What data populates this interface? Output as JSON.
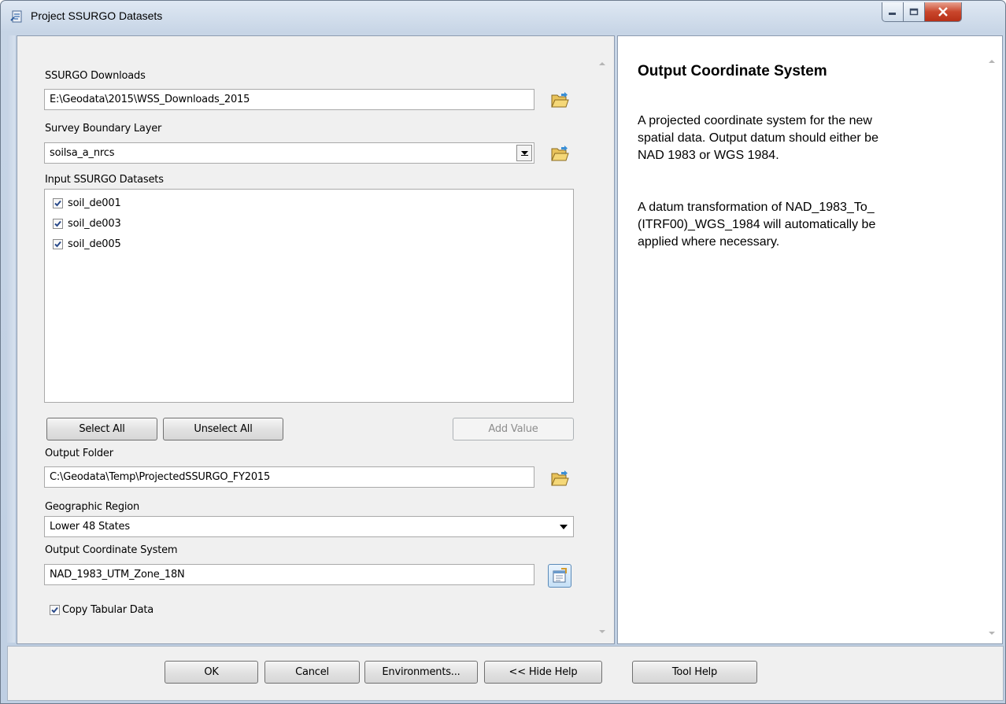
{
  "window": {
    "title": "Project SSURGO Datasets"
  },
  "form": {
    "ssurgo_downloads": {
      "label": "SSURGO Downloads",
      "value": "E:\\Geodata\\2015\\WSS_Downloads_2015"
    },
    "survey_boundary_layer": {
      "label": "Survey Boundary Layer",
      "value": "soilsa_a_nrcs"
    },
    "input_datasets": {
      "label": "Input SSURGO Datasets",
      "items": [
        {
          "label": "soil_de001",
          "checked": true
        },
        {
          "label": "soil_de003",
          "checked": true
        },
        {
          "label": "soil_de005",
          "checked": true
        }
      ]
    },
    "select_all_label": "Select All",
    "unselect_all_label": "Unselect All",
    "add_value_label": "Add Value",
    "output_folder": {
      "label": "Output Folder",
      "value": "C:\\Geodata\\Temp\\ProjectedSSURGO_FY2015"
    },
    "geographic_region": {
      "label": "Geographic Region",
      "value": "Lower 48 States"
    },
    "output_coordinate_system": {
      "label": "Output Coordinate System",
      "value": "NAD_1983_UTM_Zone_18N"
    },
    "copy_tabular": {
      "label": "Copy Tabular Data",
      "checked": true
    }
  },
  "help": {
    "title": "Output Coordinate System",
    "paragraph1_lines": [
      "A projected coordinate system for the new",
      "spatial data. Output datum should either be",
      "NAD 1983 or WGS 1984."
    ],
    "paragraph2_lines": [
      "A datum transformation of NAD_1983_To_",
      "(ITRF00)_WGS_1984 will automatically be",
      "applied where necessary."
    ]
  },
  "buttons": {
    "ok": "OK",
    "cancel": "Cancel",
    "environments": "Environments...",
    "hide_help": "<< Hide Help",
    "tool_help": "Tool Help"
  },
  "icons": {
    "app": "toolbox-script-icon",
    "folder": "open-folder-icon",
    "coordinate": "coordinate-properties-icon"
  },
  "colors": {
    "title_bar": "#c7d5e6",
    "close_button": "#c9462c",
    "panel_bg": "#f0f0f0",
    "help_bg": "#ffffff",
    "folder_icon": "#e8c25a"
  }
}
